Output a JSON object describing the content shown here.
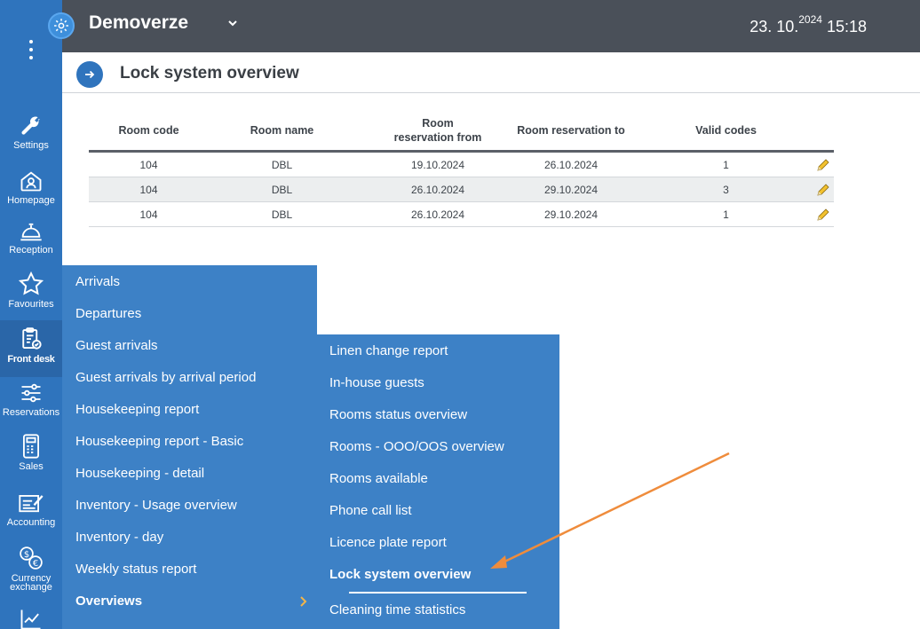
{
  "app": {
    "title": "Demoverze",
    "date": "23. 10.",
    "year": "2024",
    "time": "15:18"
  },
  "page": {
    "title": "Lock system overview"
  },
  "table": {
    "headers": [
      "Room code",
      "Room name",
      "Room reservation from",
      "Room reservation to",
      "Valid codes"
    ],
    "rows": [
      {
        "code": "104",
        "name": "DBL",
        "from": "19.10.2024",
        "to": "26.10.2024",
        "valid": "1"
      },
      {
        "code": "104",
        "name": "DBL",
        "from": "26.10.2024",
        "to": "29.10.2024",
        "valid": "3"
      },
      {
        "code": "104",
        "name": "DBL",
        "from": "26.10.2024",
        "to": "29.10.2024",
        "valid": "1"
      }
    ]
  },
  "sidebar": {
    "items": [
      {
        "label": "Settings",
        "icon": "wrench-icon"
      },
      {
        "label": "Homepage",
        "icon": "home-icon"
      },
      {
        "label": "Reception",
        "icon": "bell-icon"
      },
      {
        "label": "Favourites",
        "icon": "star-icon"
      },
      {
        "label": "Front desk",
        "icon": "clipboard-icon"
      },
      {
        "label": "Reservations",
        "icon": "sliders-icon"
      },
      {
        "label": "Sales",
        "icon": "register-icon"
      },
      {
        "label": "Accounting",
        "icon": "ledger-icon"
      },
      {
        "label": "Currency exchange",
        "icon": "currency-icon"
      },
      {
        "label": "",
        "icon": "chart-icon"
      }
    ]
  },
  "menu_main": {
    "items": [
      "Arrivals",
      "Departures",
      "Guest arrivals",
      "Guest arrivals by arrival period",
      "Housekeeping report",
      "Housekeeping report - Basic",
      "Housekeeping - detail",
      "Inventory - Usage overview",
      "Inventory - day",
      "Weekly status report",
      "Overviews"
    ]
  },
  "menu_sub": {
    "items": [
      "Linen change report",
      "In-house guests",
      "Rooms status overview",
      "Rooms - OOO/OOS overview",
      "Rooms available",
      "Phone call list",
      "Licence plate report",
      "Lock system overview",
      "Cleaning time statistics"
    ]
  },
  "colors": {
    "sidebar": "#2f74bd",
    "topbar": "#4a5059",
    "menu": "#3d81c6",
    "annotation_arrow": "#ef8c3c"
  }
}
